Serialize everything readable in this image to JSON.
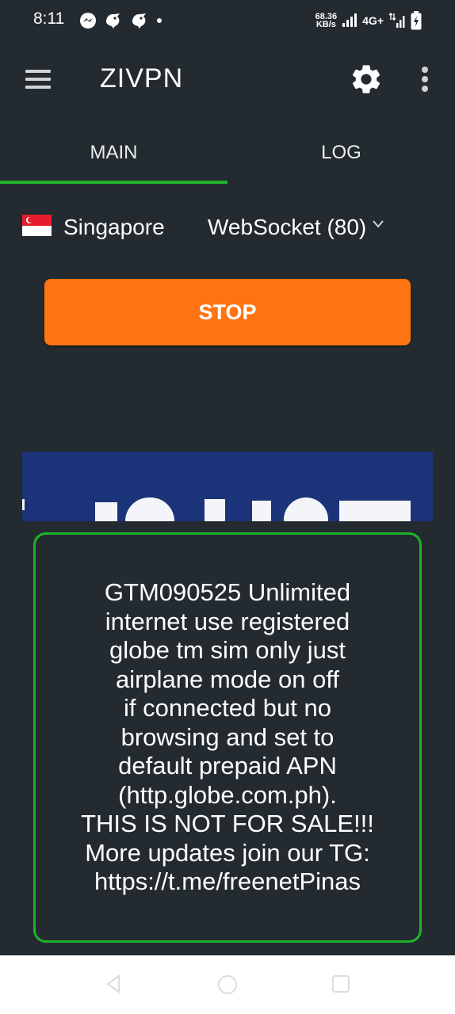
{
  "status_bar": {
    "time": "8:11",
    "net_speed_value": "68.36",
    "net_speed_unit": "KB/s",
    "network_type": "4G+",
    "icons": [
      "messenger-icon",
      "bird-icon",
      "bird-icon",
      "dot-icon",
      "signal-icon",
      "signal-icon",
      "battery-charging-icon"
    ]
  },
  "app_bar": {
    "title": "ZIVPN",
    "icons": [
      "hamburger-menu-icon",
      "gear-icon",
      "more-vert-icon"
    ]
  },
  "tabs": [
    {
      "label": "MAIN",
      "selected": true
    },
    {
      "label": "LOG",
      "selected": false
    }
  ],
  "server": {
    "country": "Singapore",
    "flag": "singapore-flag-icon",
    "protocol": "WebSocket (80)"
  },
  "action_button": {
    "label": "STOP"
  },
  "message": {
    "text": "GTM090525 Unlimited\ninternet use registered\nglobe tm sim only just\nairplane mode on off\nif connected but no\nbrowsing and set to\ndefault prepaid APN\n(http.globe.com.ph).\nTHIS IS NOT FOR SALE!!!\nMore updates join our TG:\nhttps://t.me/freenetPinas"
  },
  "colors": {
    "background": "#242b30",
    "accent_green": "#1db32a",
    "stop_orange": "#ff7412",
    "banner_blue": "#1b3378"
  }
}
